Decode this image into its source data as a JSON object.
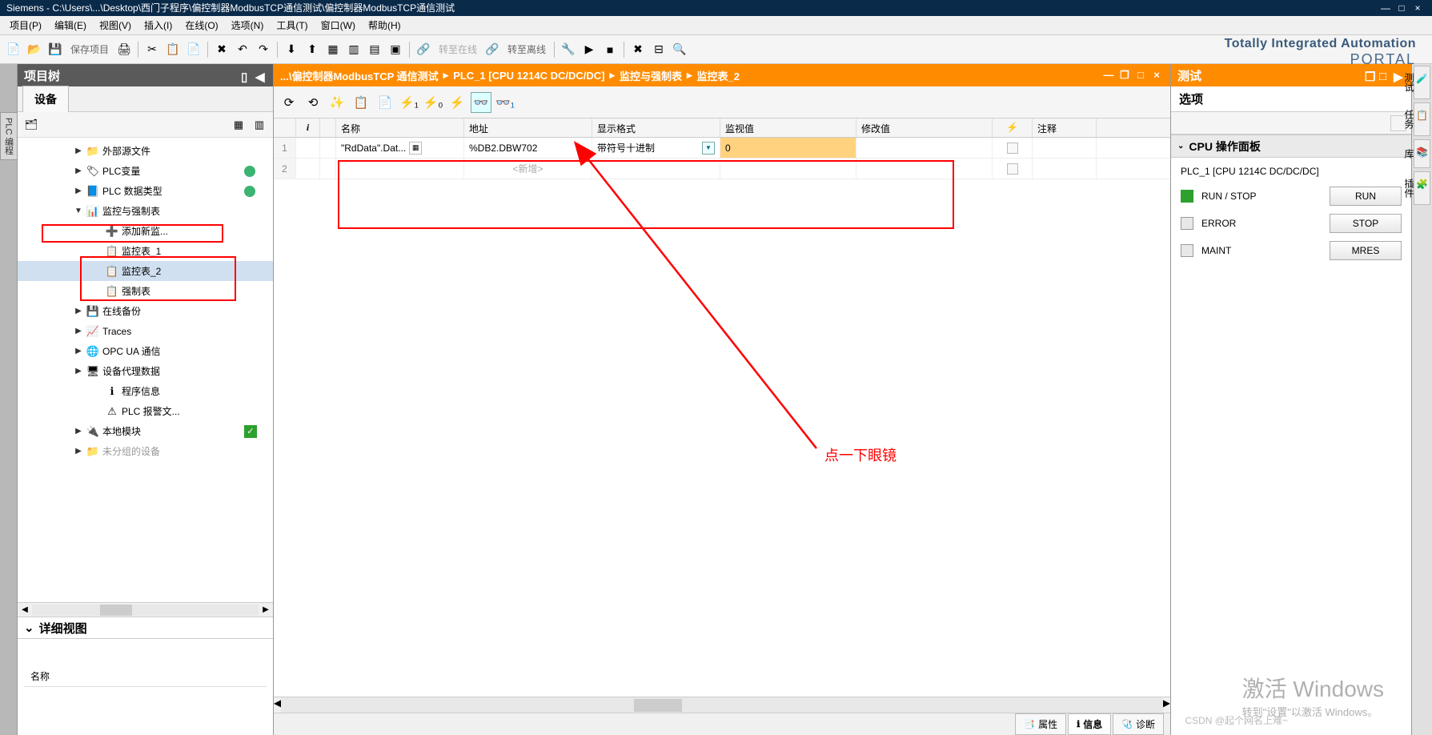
{
  "titlebar": "Siemens - C:\\Users\\...\\Desktop\\西门子程序\\偏控制器ModbusTCP通信测试\\偏控制器ModbusTCP通信测试",
  "menu": {
    "project": "项目(P)",
    "edit": "编辑(E)",
    "view": "视图(V)",
    "insert": "插入(I)",
    "online": "在线(O)",
    "options": "选项(N)",
    "tools": "工具(T)",
    "window": "窗口(W)",
    "help": "帮助(H)"
  },
  "toolbar": {
    "save": "保存项目",
    "goonline": "转至在线",
    "gooffline": "转至离线"
  },
  "brand": {
    "l1": "Totally Integrated Automation",
    "l2": "PORTAL"
  },
  "left": {
    "title": "项目树",
    "tab": "设备",
    "sidetab": "PLC 编程",
    "detail": "详细视图",
    "namecol": "名称"
  },
  "tree": {
    "ext_src": "外部源文件",
    "plc_vars": "PLC变量",
    "plc_types": "PLC 数据类型",
    "watch_force": "监控与强制表",
    "add_watch": "添加新监...",
    "watch1": "监控表_1",
    "watch2": "监控表_2",
    "force": "强制表",
    "online_bak": "在线备份",
    "traces": "Traces",
    "opcua": "OPC UA 通信",
    "proxy": "设备代理数据",
    "proginfo": "程序信息",
    "alarm": "PLC 报警文...",
    "localmod": "本地模块",
    "ungrouped": "未分组的设备"
  },
  "breadcrumb": {
    "p1": "...\\偏控制器ModbusTCP 通信测试",
    "p2": "PLC_1 [CPU 1214C DC/DC/DC]",
    "p3": "监控与强制表",
    "p4": "监控表_2"
  },
  "grid": {
    "h_name": "名称",
    "h_addr": "地址",
    "h_fmt": "显示格式",
    "h_mon": "监视值",
    "h_mod": "修改值",
    "h_flash": "⚡",
    "h_comment": "注释",
    "r1_name": "\"RdData\".Dat...",
    "r1_addr": "%DB2.DBW702",
    "r1_fmt": "带符号十进制",
    "r1_mon": "0",
    "new": "<新增>"
  },
  "annotation": "点一下眼镜",
  "right": {
    "title": "测试",
    "options": "选项",
    "cpu_panel": "CPU 操作面板",
    "cpu_name": "PLC_1 [CPU 1214C DC/DC/DC]",
    "runstop": "RUN / STOP",
    "error": "ERROR",
    "maint": "MAINT",
    "btn_run": "RUN",
    "btn_stop": "STOP",
    "btn_mres": "MRES"
  },
  "sidetabs": {
    "t1": "测试",
    "t2": "任务",
    "t3": "库",
    "t4": "插件"
  },
  "bottom": {
    "props": "属性",
    "info": "信息",
    "diag": "诊断"
  },
  "watermark": {
    "main": "激活 Windows",
    "sub": "转到\"设置\"以激活 Windows。"
  },
  "csdn": "CSDN @起个网名上难~"
}
